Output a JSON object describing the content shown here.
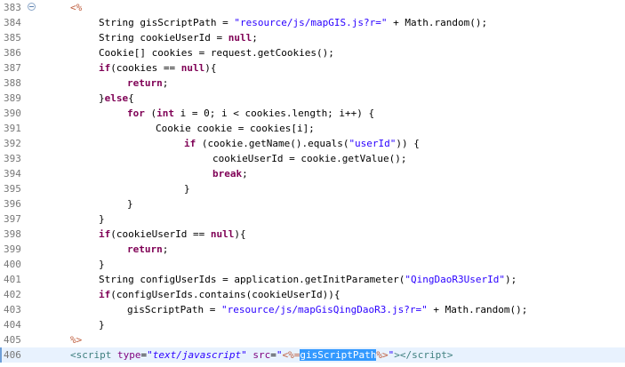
{
  "editor": {
    "lines": [
      {
        "num": "383",
        "indent": 1,
        "tokens": [
          {
            "t": "jsp",
            "v": "<%"
          }
        ]
      },
      {
        "num": "384",
        "indent": 2,
        "tokens": [
          {
            "t": "plain",
            "v": "String gisScriptPath = "
          },
          {
            "t": "str",
            "v": "\"resource/js/mapGIS.js?r=\""
          },
          {
            "t": "plain",
            "v": " + Math.random();"
          }
        ]
      },
      {
        "num": "385",
        "indent": 2,
        "tokens": [
          {
            "t": "plain",
            "v": "String cookieUserId = "
          },
          {
            "t": "kw",
            "v": "null"
          },
          {
            "t": "plain",
            "v": ";"
          }
        ]
      },
      {
        "num": "386",
        "indent": 2,
        "tokens": [
          {
            "t": "plain",
            "v": "Cookie[] cookies = request.getCookies();"
          }
        ]
      },
      {
        "num": "387",
        "indent": 2,
        "tokens": [
          {
            "t": "kw",
            "v": "if"
          },
          {
            "t": "plain",
            "v": "(cookies == "
          },
          {
            "t": "kw",
            "v": "null"
          },
          {
            "t": "plain",
            "v": "){"
          }
        ]
      },
      {
        "num": "388",
        "indent": 3,
        "tokens": [
          {
            "t": "kw",
            "v": "return"
          },
          {
            "t": "plain",
            "v": ";"
          }
        ]
      },
      {
        "num": "389",
        "indent": 2,
        "tokens": [
          {
            "t": "plain",
            "v": "}"
          },
          {
            "t": "kw",
            "v": "else"
          },
          {
            "t": "plain",
            "v": "{"
          }
        ]
      },
      {
        "num": "390",
        "indent": 3,
        "tokens": [
          {
            "t": "kw",
            "v": "for"
          },
          {
            "t": "plain",
            "v": " ("
          },
          {
            "t": "kw",
            "v": "int"
          },
          {
            "t": "plain",
            "v": " i = 0; i < cookies.length; i++) {"
          }
        ]
      },
      {
        "num": "391",
        "indent": 4,
        "tokens": [
          {
            "t": "plain",
            "v": "Cookie cookie = cookies[i];"
          }
        ]
      },
      {
        "num": "392",
        "indent": 5,
        "tokens": [
          {
            "t": "kw",
            "v": "if"
          },
          {
            "t": "plain",
            "v": " (cookie.getName().equals("
          },
          {
            "t": "str",
            "v": "\"userId\""
          },
          {
            "t": "plain",
            "v": ")) {"
          }
        ]
      },
      {
        "num": "393",
        "indent": 6,
        "tokens": [
          {
            "t": "plain",
            "v": "cookieUserId = cookie.getValue();"
          }
        ]
      },
      {
        "num": "394",
        "indent": 6,
        "tokens": [
          {
            "t": "kw",
            "v": "break"
          },
          {
            "t": "plain",
            "v": ";"
          }
        ]
      },
      {
        "num": "395",
        "indent": 5,
        "tokens": [
          {
            "t": "plain",
            "v": "}"
          }
        ]
      },
      {
        "num": "396",
        "indent": 3,
        "tokens": [
          {
            "t": "plain",
            "v": "}"
          }
        ]
      },
      {
        "num": "397",
        "indent": 2,
        "tokens": [
          {
            "t": "plain",
            "v": "}"
          }
        ]
      },
      {
        "num": "398",
        "indent": 2,
        "tokens": [
          {
            "t": "kw",
            "v": "if"
          },
          {
            "t": "plain",
            "v": "(cookieUserId == "
          },
          {
            "t": "kw",
            "v": "null"
          },
          {
            "t": "plain",
            "v": "){"
          }
        ]
      },
      {
        "num": "399",
        "indent": 3,
        "tokens": [
          {
            "t": "kw",
            "v": "return"
          },
          {
            "t": "plain",
            "v": ";"
          }
        ]
      },
      {
        "num": "400",
        "indent": 2,
        "tokens": [
          {
            "t": "plain",
            "v": "}"
          }
        ]
      },
      {
        "num": "401",
        "indent": 2,
        "tokens": [
          {
            "t": "plain",
            "v": "String configUserIds = application.getInitParameter("
          },
          {
            "t": "str",
            "v": "\"QingDaoR3UserId\""
          },
          {
            "t": "plain",
            "v": ");"
          }
        ]
      },
      {
        "num": "402",
        "indent": 2,
        "tokens": [
          {
            "t": "kw",
            "v": "if"
          },
          {
            "t": "plain",
            "v": "(configUserIds.contains(cookieUserId)){"
          }
        ]
      },
      {
        "num": "403",
        "indent": 3,
        "tokens": [
          {
            "t": "plain",
            "v": "gisScriptPath = "
          },
          {
            "t": "str",
            "v": "\"resource/js/mapGisQingDaoR3.js?r=\""
          },
          {
            "t": "plain",
            "v": " + Math.random();"
          }
        ]
      },
      {
        "num": "404",
        "indent": 2,
        "tokens": [
          {
            "t": "plain",
            "v": "}"
          }
        ]
      },
      {
        "num": "405",
        "indent": 1,
        "tokens": [
          {
            "t": "jsp",
            "v": "%>"
          }
        ]
      },
      {
        "num": "406",
        "indent": 1,
        "current": true,
        "tokens": [
          {
            "t": "tag",
            "v": "<script"
          },
          {
            "t": "plain",
            "v": " "
          },
          {
            "t": "attr",
            "v": "type"
          },
          {
            "t": "plain",
            "v": "="
          },
          {
            "t": "attrval",
            "v": "\"text/javascript\""
          },
          {
            "t": "plain",
            "v": " "
          },
          {
            "t": "attr",
            "v": "src"
          },
          {
            "t": "plain",
            "v": "="
          },
          {
            "t": "attrval",
            "v": "\""
          },
          {
            "t": "jsp",
            "v": "<%="
          },
          {
            "t": "hl",
            "v": "gisScriptPath"
          },
          {
            "t": "jsp",
            "v": "%>"
          },
          {
            "t": "attrval",
            "v": "\""
          },
          {
            "t": "tag",
            "v": "></script"
          },
          {
            "t": "tag",
            "v": ">"
          }
        ]
      }
    ],
    "fold_marker_line": "383",
    "colors": {
      "keyword": "#7f0055",
      "string": "#2a00ff",
      "jsp_delimiter": "#bf5f3f",
      "tag": "#3f7f7f",
      "attribute": "#7f007f",
      "line_number": "#787878",
      "current_line_bg": "#e8f2fe",
      "selection_bg": "#3399ff"
    },
    "icons": {
      "fold": "fold-collapse-icon"
    }
  }
}
